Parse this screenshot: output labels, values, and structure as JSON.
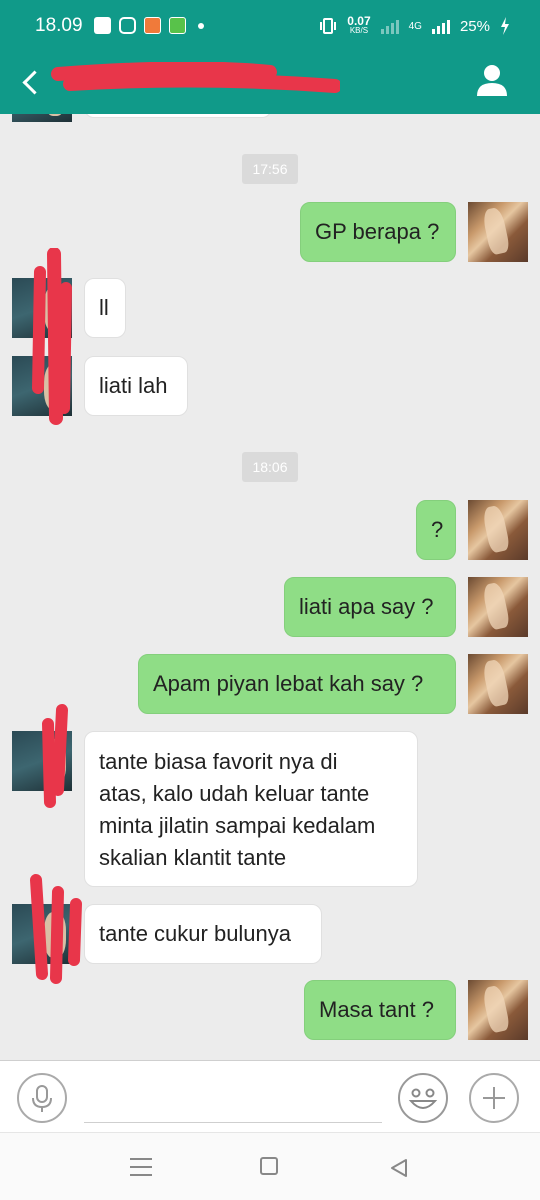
{
  "status_bar": {
    "time": "18.09",
    "speed_value": "0.07",
    "speed_unit": "KB/S",
    "network": "4G",
    "battery": "25%",
    "app_icons": [
      "facebook-icon",
      "instagram-icon",
      "game-icon",
      "app-store-icon",
      "notification-dot"
    ]
  },
  "header": {
    "back_icon": "chevron-left-icon",
    "contact_name": "",
    "profile_icon": "user-icon"
  },
  "messages": [
    {
      "type": "timestamp",
      "text": "17:56"
    },
    {
      "type": "out",
      "text": "GP berapa ?"
    },
    {
      "type": "in",
      "text": "ll"
    },
    {
      "type": "in",
      "text": "liati lah"
    },
    {
      "type": "timestamp",
      "text": "18:06"
    },
    {
      "type": "out",
      "text": "?"
    },
    {
      "type": "out",
      "text": "liati apa say ?"
    },
    {
      "type": "out",
      "text": "Apam piyan lebat kah say ?"
    },
    {
      "type": "in",
      "text": "tante biasa favorit nya di\natas, kalo udah keluar tante\nminta jilatin sampai kedalam\nskalian klantit tante"
    },
    {
      "type": "in",
      "text": "tante cukur bulunya"
    },
    {
      "type": "out",
      "text": "Masa tant ?"
    }
  ],
  "input_bar": {
    "mic_icon": "microphone-icon",
    "placeholder": "",
    "emoji_icon": "smiley-icon",
    "attach_icon": "plus-icon"
  },
  "nav_bar": {
    "icons": [
      "recent-apps-icon",
      "home-icon",
      "back-triangle-icon"
    ]
  },
  "colors": {
    "header": "#109a89",
    "outgoing_bubble": "#8fdd86",
    "incoming_bubble": "#ffffff",
    "chat_background": "#ececec",
    "redaction": "#e8364a"
  }
}
